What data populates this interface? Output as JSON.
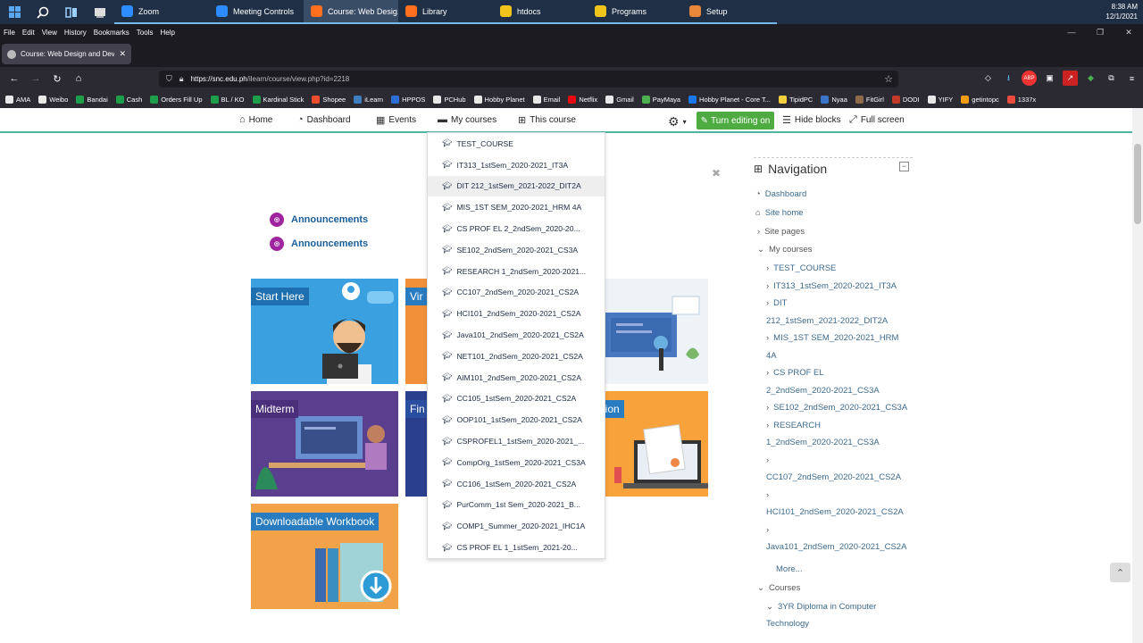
{
  "taskbar": {
    "apps": [
      {
        "label": "Zoom",
        "color": "#2d8cff",
        "active": false
      },
      {
        "label": "Meeting Controls",
        "color": "#2d8cff",
        "active": false
      },
      {
        "label": "Course: Web Desig...",
        "color": "#ff6f1e",
        "active": true
      },
      {
        "label": "Library",
        "color": "#ff6f1e",
        "active": false
      },
      {
        "label": "htdocs",
        "color": "#f0c419",
        "active": false
      },
      {
        "label": "Programs",
        "color": "#f0c419",
        "active": false
      },
      {
        "label": "Setup",
        "color": "#e8863a",
        "active": false
      }
    ],
    "time": "8:38 AM",
    "date": "12/1/2021"
  },
  "menubar": {
    "items": [
      "File",
      "Edit",
      "View",
      "History",
      "Bookmarks",
      "Tools",
      "Help"
    ]
  },
  "tab": {
    "title": "Course: Web Design and Devel"
  },
  "url": {
    "host": "https://snc.edu.ph",
    "path": "/ilearn/course/view.php?id=2218"
  },
  "bookmarks": [
    {
      "label": "AMA",
      "color": "#e8e8e8"
    },
    {
      "label": "Weibo",
      "color": "#e8e8e8"
    },
    {
      "label": "Bandai",
      "color": "#1e9e4a"
    },
    {
      "label": "Cash",
      "color": "#1e9e4a"
    },
    {
      "label": "Orders Fill Up",
      "color": "#1e9e4a"
    },
    {
      "label": "BL / KO",
      "color": "#1e9e4a"
    },
    {
      "label": "Kardinal Stick",
      "color": "#1e9e4a"
    },
    {
      "label": "Shopee",
      "color": "#ee4d2d"
    },
    {
      "label": "iLearn",
      "color": "#3f7fbf"
    },
    {
      "label": "HPPOS",
      "color": "#2a6fd6"
    },
    {
      "label": "PCHub",
      "color": "#e8e8e8"
    },
    {
      "label": "Hobby Planet",
      "color": "#e8e8e8"
    },
    {
      "label": "Email",
      "color": "#e8e8e8"
    },
    {
      "label": "Netflix",
      "color": "#e50914"
    },
    {
      "label": "Gmail",
      "color": "#e8e8e8"
    },
    {
      "label": "PayMaya",
      "color": "#4caf50"
    },
    {
      "label": "Hobby Planet - Core T...",
      "color": "#1877f2"
    },
    {
      "label": "TipidPC",
      "color": "#f4d03f"
    },
    {
      "label": "Nyaa",
      "color": "#3b73c7"
    },
    {
      "label": "FitGirl",
      "color": "#8e6b4a"
    },
    {
      "label": "DODI",
      "color": "#c0392b"
    },
    {
      "label": "YIFY",
      "color": "#e8e8e8"
    },
    {
      "label": "getintopc",
      "color": "#f39c12"
    },
    {
      "label": "1337x",
      "color": "#e74c3c"
    }
  ],
  "topnav": {
    "home": "Home",
    "dashboard": "Dashboard",
    "events": "Events",
    "my_courses": "My courses",
    "this_course": "This course",
    "turn_editing": "Turn editing on",
    "hide_blocks": "Hide blocks",
    "full_screen": "Full screen"
  },
  "announcements": [
    "Announcements",
    "Announcements"
  ],
  "tiles": [
    {
      "label": "Start Here",
      "bg": "#3aa0e0",
      "label_bg": "#1d6fb0"
    },
    {
      "label": "Vir",
      "bg": "#f2903a",
      "label_bg": "#2a7cc0"
    },
    {
      "label": "",
      "bg": "#e8eef4",
      "label_bg": ""
    },
    {
      "label": "Midterm",
      "bg": "#5b3f8f",
      "label_bg": "#4a2f7a"
    },
    {
      "label": "Fin",
      "bg": "#2b3f8f",
      "label_bg": "#2a4fa0"
    },
    {
      "label": "Completion",
      "bg": "#f7a23a",
      "label_bg": "#2a7cc0"
    },
    {
      "label": "Downloadable Workbook",
      "bg": "#f2a34a",
      "label_bg": "#2a7cc0"
    }
  ],
  "dropdown": {
    "items": [
      "TEST_COURSE",
      "IT313_1stSem_2020-2021_IT3A",
      "DIT 212_1stSem_2021-2022_DIT2A",
      "MIS_1ST SEM_2020-2021_HRM 4A",
      "CS PROF EL 2_2ndSem_2020-20...",
      "SE102_2ndSem_2020-2021_CS3A",
      "RESEARCH 1_2ndSem_2020-2021...",
      "CC107_2ndSem_2020-2021_CS2A",
      "HCI101_2ndSem_2020-2021_CS2A",
      "Java101_2ndSem_2020-2021_CS2A",
      "NET101_2ndSem_2020-2021_CS2A",
      "AIM101_2ndSem_2020-2021_CS2A",
      "CC105_1stSem_2020-2021_CS2A",
      "OOP101_1stSem_2020-2021_CS2A",
      "CSPROFEL1_1stSem_2020-2021_...",
      "CompOrg_1stSem_2020-2021_CS3A",
      "CC106_1stSem_2020-2021_CS2A",
      "PurComm_1st Sem_2020-2021_B...",
      "COMP1_Summer_2020-2021_IHC1A",
      "CS PROF EL 1_1stSem_2021-20..."
    ],
    "highlighted_index": 2
  },
  "navigation": {
    "title": "Navigation",
    "dashboard": "Dashboard",
    "site_home": "Site home",
    "site_pages": "Site pages",
    "my_courses": "My courses",
    "courses_list": [
      {
        "lines": [
          "TEST_COURSE"
        ]
      },
      {
        "lines": [
          "IT313_1stSem_2020-2021_IT3A"
        ]
      },
      {
        "lines": [
          "DIT",
          "212_1stSem_2021-2022_DIT2A"
        ]
      },
      {
        "lines": [
          "MIS_1ST SEM_2020-2021_HRM",
          "4A"
        ]
      },
      {
        "lines": [
          "CS PROF EL",
          "2_2ndSem_2020-2021_CS3A"
        ]
      },
      {
        "lines": [
          "SE102_2ndSem_2020-2021_CS3A"
        ]
      },
      {
        "lines": [
          "RESEARCH",
          "1_2ndSem_2020-2021_CS3A"
        ]
      },
      {
        "lines": [
          "",
          "CC107_2ndSem_2020-2021_CS2A"
        ]
      },
      {
        "lines": [
          "",
          "HCI101_2ndSem_2020-2021_CS2A"
        ]
      },
      {
        "lines": [
          "",
          "Java101_2ndSem_2020-2021_CS2A"
        ]
      }
    ],
    "more": "More...",
    "courses": "Courses",
    "category": [
      "3YR Diploma in Computer",
      "Technology"
    ]
  }
}
